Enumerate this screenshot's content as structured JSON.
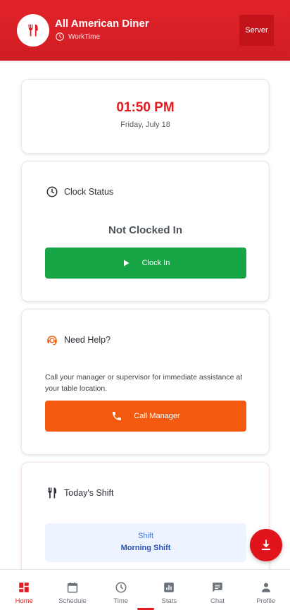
{
  "header": {
    "app_name": "All American Diner",
    "subtitle": "WorkTime",
    "role_button": "Server",
    "logo_icon": "utensils-icon",
    "subtitle_icon": "clock-icon"
  },
  "time_card": {
    "time": "01:50 PM",
    "date": "Friday, July 18"
  },
  "clock_card": {
    "title": "Clock Status",
    "title_icon": "clock-icon",
    "status": "Not Clocked In",
    "button_label": "Clock In",
    "button_icon": "play-icon"
  },
  "help_card": {
    "title": "Need Help?",
    "title_icon": "support-agent-icon",
    "text": "Call your manager or supervisor for immediate assistance at your table location.",
    "button_label": "Call Manager",
    "button_icon": "phone-icon"
  },
  "shift_card": {
    "title": "Today's Shift",
    "title_icon": "utensils-icon",
    "shift_label": "Shift",
    "shift_name": "Morning Shift"
  },
  "fab": {
    "icon": "download-icon"
  },
  "nav": {
    "items": [
      {
        "label": "Home",
        "icon": "dashboard-icon"
      },
      {
        "label": "Schedule",
        "icon": "calendar-icon"
      },
      {
        "label": "Time",
        "icon": "clock-icon"
      },
      {
        "label": "Stats",
        "icon": "bar-chart-icon"
      },
      {
        "label": "Chat",
        "icon": "chat-icon"
      },
      {
        "label": "Profile",
        "icon": "person-icon"
      }
    ]
  },
  "colors": {
    "brand_red": "#e21b22",
    "clock_in_green": "#17a546",
    "call_orange": "#f35a0f",
    "shift_blue": "#2953b8"
  }
}
